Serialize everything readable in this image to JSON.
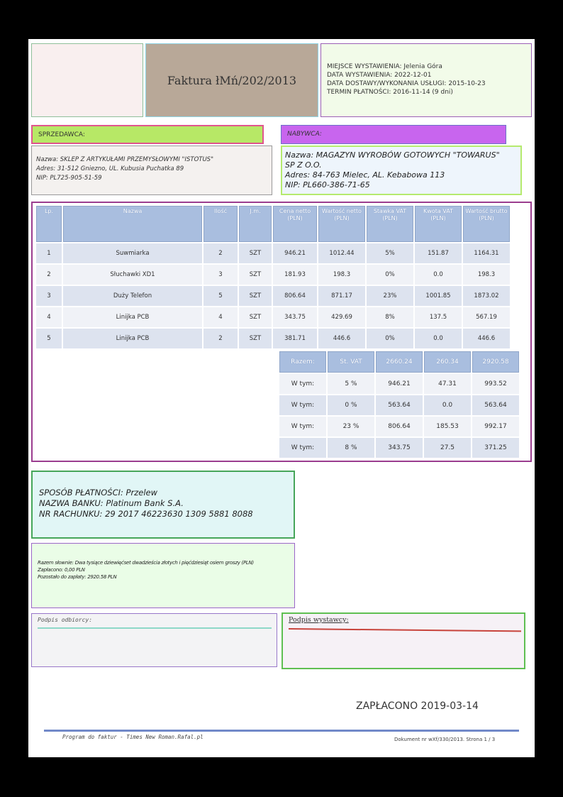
{
  "invoice": {
    "title": "Faktura łMń/202/2013",
    "meta": [
      "MIEJSCE WYSTAWIENIA: Jelenia Góra",
      "DATA WYSTAWIENIA: 2022-12-01",
      "DATA DOSTAWY/WYKONANIA USŁUGI: 2015-10-23",
      "TERMIN PŁATNOŚCI: 2016-11-14 (9 dni)"
    ]
  },
  "seller": {
    "header": "SPRZEDAWCA:",
    "lines": [
      "Nazwa: SKLEP Z ARTYKUŁAMI PRZEMYSŁOWYMI \"ISTOTUS\"",
      "Adres: 31-512 Gniezno, UL. Kubusia Puchatka 89",
      "NIP: PL725-905-51-59"
    ]
  },
  "buyer": {
    "header": "NABYWCA:",
    "lines": [
      "Nazwa:  MAGAZYN  WYROBÓW GOTOWYCH \"TOWARUS\"",
      "SP Z O.O.",
      "Adres:  84-763  Mielec, AL. Kebabowa  113",
      "NIP:  PL660-386-71-65"
    ]
  },
  "items_table": {
    "headers": [
      "Lp.",
      "Nazwa",
      "Ilość",
      "J.m.",
      "Cena netto (PLN)",
      "Wartość netto (PLN)",
      "Stawka VAT (PLN)",
      "Kwota VAT (PLN)",
      "Wartość brutto (PLN)"
    ],
    "rows": [
      [
        "1",
        "Suwmiarka",
        "2",
        "SZT",
        "946.21",
        "1012.44",
        "5%",
        "151.87",
        "1164.31"
      ],
      [
        "2",
        "Słuchawki XD1",
        "3",
        "SZT",
        "181.93",
        "198.3",
        "0%",
        "0.0",
        "198.3"
      ],
      [
        "3",
        "Duży Telefon",
        "5",
        "SZT",
        "806.64",
        "871.17",
        "23%",
        "1001.85",
        "1873.02"
      ],
      [
        "4",
        "Linijka PCB",
        "4",
        "SZT",
        "343.75",
        "429.69",
        "8%",
        "137.5",
        "567.19"
      ],
      [
        "5",
        "Linijka PCB",
        "2",
        "SZT",
        "381.71",
        "446.6",
        "0%",
        "0.0",
        "446.6"
      ]
    ]
  },
  "totals_table": {
    "headers": [
      "Razem:",
      "St. VAT",
      "2660.24",
      "260.34",
      "2920.58"
    ],
    "rows": [
      [
        "W tym:",
        "5 %",
        "946.21",
        "47.31",
        "993.52"
      ],
      [
        "W tym:",
        "0 %",
        "563.64",
        "0.0",
        "563.64"
      ],
      [
        "W tym:",
        "23 %",
        "806.64",
        "185.53",
        "992.17"
      ],
      [
        "W tym:",
        "8 %",
        "343.75",
        "27.5",
        "371.25"
      ]
    ]
  },
  "payment": {
    "method": "SPOSÓB PŁATNOŚCI: Przelew",
    "bank": "NAZWA BANKU: Platinum  Bank S.A.",
    "account": "NR RACHUNKU: 29 2017 46223630 1309 5881 8088"
  },
  "summary": {
    "in_words": "Razem słownie: Dwa tysiące dziewięćset dwadzieścia złotych i pięćdziesiąt osiem groszy (PLN)",
    "paid": "Zapłacono: 0,00 PLN",
    "remaining": "Pozostało do zapłaty: 2920.58 PLN"
  },
  "signatures": {
    "receiver": "Podpis odbiorcy:",
    "issuer": "Podpis wystawcy:"
  },
  "paid_stamp": "ZAPŁACONO 2019-03-14",
  "footer": {
    "left": "Program do faktur - Times New Roman.Rafal.pl",
    "right": "Dokument nr wXf/330/2013. Strona 1 / 3"
  }
}
